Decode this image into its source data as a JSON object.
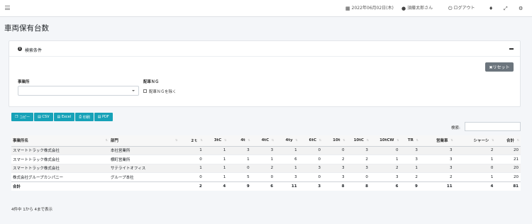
{
  "topbar": {
    "date": "2022年06月02日(木)",
    "user": "須藤太郎さん",
    "logout": "ログアウト"
  },
  "page_title": "車両保有台数",
  "search_panel": {
    "title": "検索条件",
    "reset_label": "✖リセット",
    "office_label": "事業所",
    "office_value": "",
    "ng_label": "配車ＮＧ",
    "ng_checkbox_label": "配車ＮＧを除く"
  },
  "export_buttons": [
    {
      "label": "コピー",
      "icon": "copy-icon"
    },
    {
      "label": "CSV",
      "icon": "file-icon"
    },
    {
      "label": "Excel",
      "icon": "file-icon"
    },
    {
      "label": "印刷",
      "icon": "print-icon"
    },
    {
      "label": "PDF",
      "icon": "file-icon"
    }
  ],
  "search_label": "検索:",
  "table": {
    "columns": [
      "事業所名",
      "部門",
      "2ｔ",
      "3tC",
      "4t",
      "4tC",
      "4ty",
      "6tC",
      "10t",
      "10tC",
      "10tCW",
      "TR",
      "営業車",
      "シャーシ",
      "合計"
    ],
    "rows": [
      [
        "スマートトラック株式会社",
        "本社営業所",
        "1",
        "1",
        "3",
        "3",
        "1",
        "0",
        "0",
        "3",
        "0",
        "3",
        "3",
        "2",
        "20"
      ],
      [
        "スマートトラック株式会社",
        "横町営業所",
        "0",
        "1",
        "1",
        "1",
        "6",
        "0",
        "2",
        "2",
        "1",
        "3",
        "3",
        "1",
        "21"
      ],
      [
        "スマートトラック株式会社",
        "サテライトオフィス",
        "1",
        "1",
        "0",
        "2",
        "1",
        "3",
        "3",
        "3",
        "2",
        "1",
        "3",
        "0",
        "20"
      ],
      [
        "株式会社グループカンパニー",
        "グループ本社",
        "0",
        "1",
        "5",
        "0",
        "3",
        "0",
        "3",
        "0",
        "3",
        "2",
        "2",
        "1",
        "20"
      ]
    ],
    "totals": [
      "合計",
      "",
      "2",
      "4",
      "9",
      "6",
      "11",
      "3",
      "8",
      "8",
      "6",
      "9",
      "11",
      "4",
      "81"
    ]
  },
  "table_info": "4件中 1から 4まで表示"
}
